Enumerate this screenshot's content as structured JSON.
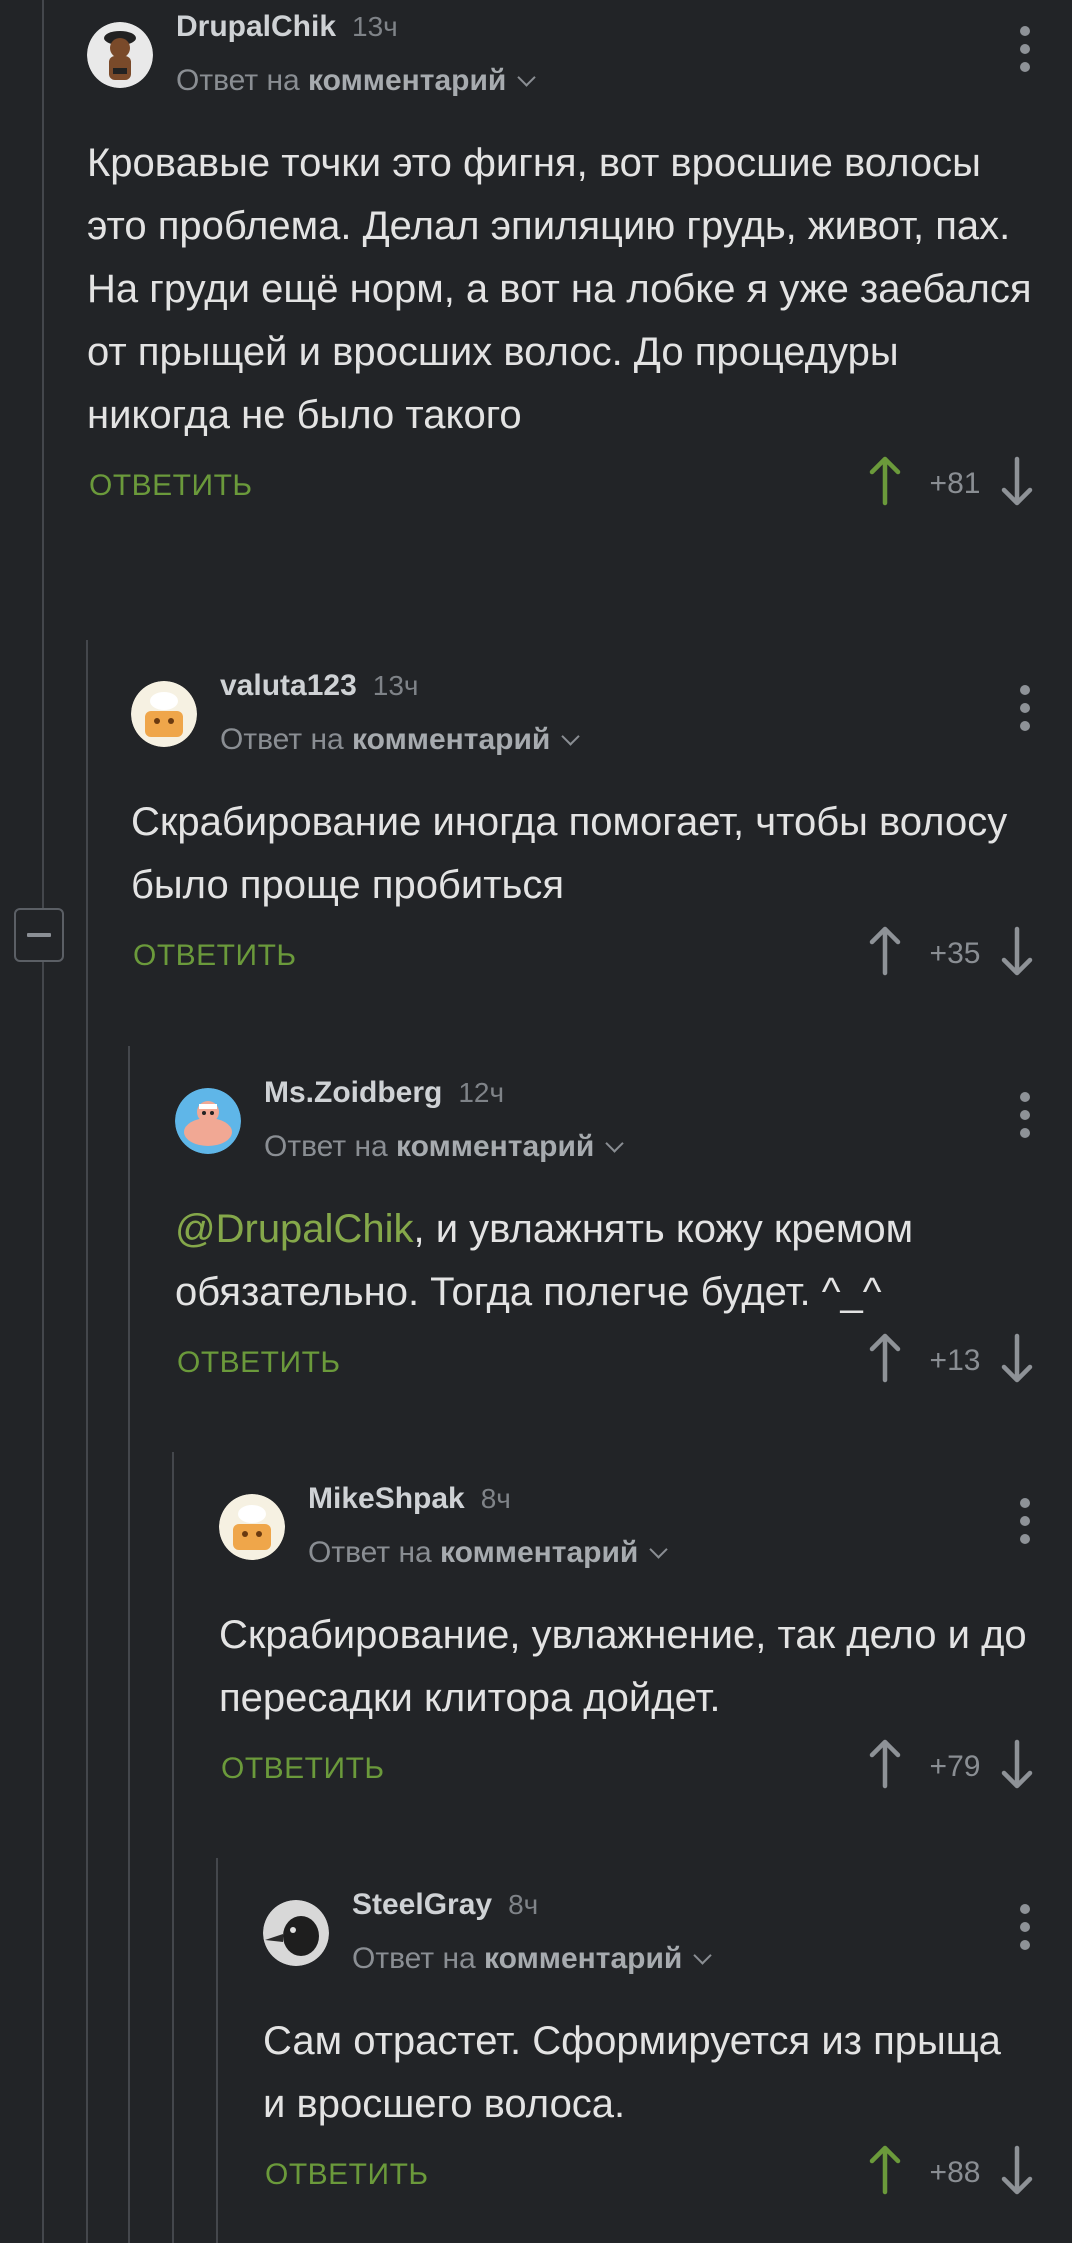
{
  "collapse_label": "−",
  "comments": [
    {
      "username": "DrupalChik",
      "time": "13ч",
      "reply_prefix": "Ответ на",
      "reply_target": "комментарий",
      "mention": "",
      "text": "Кровавые точки это фигня, вот вросшие волосы это проблема. Делал эпиляцию грудь, живот, пах. На груди ещё норм, а вот на лобке я уже заебался от прыщей и вросших волос. До процедуры никогда не было такого",
      "reply_label": "ОТВЕТИТЬ",
      "rating": "+81",
      "upvoted": true
    },
    {
      "username": "valuta123",
      "time": "13ч",
      "reply_prefix": "Ответ на",
      "reply_target": "комментарий",
      "mention": "",
      "text": "Скрабирование иногда помогает, чтобы волосу было проще пробиться",
      "reply_label": "ОТВЕТИТЬ",
      "rating": "+35",
      "upvoted": false
    },
    {
      "username": "Ms.Zoidberg",
      "time": "12ч",
      "reply_prefix": "Ответ на",
      "reply_target": "комментарий",
      "mention": "@DrupalChik",
      "text": ", и увлажнять кожу кремом обязательно. Тогда полегче будет. ^_^",
      "reply_label": "ОТВЕТИТЬ",
      "rating": "+13",
      "upvoted": false
    },
    {
      "username": "MikeShpak",
      "time": "8ч",
      "reply_prefix": "Ответ на",
      "reply_target": "комментарий",
      "mention": "",
      "text": "Скрабирование, увлажнение, так дело и до пересадки клитора дойдет.",
      "reply_label": "ОТВЕТИТЬ",
      "rating": "+79",
      "upvoted": false
    },
    {
      "username": "SteelGray",
      "time": "8ч",
      "reply_prefix": "Ответ на",
      "reply_target": "комментарий",
      "mention": "",
      "text": "Сам отрастет. Сформируется из прыща и вросшего волоса.",
      "reply_label": "ОТВЕТИТЬ",
      "rating": "+88",
      "upvoted": true
    }
  ],
  "colors": {
    "background": "#222427",
    "accent_green": "#6b9a3b",
    "mention": "#85a84a",
    "upvote_active": "#6b9a3b",
    "vote_inactive": "#8e9297"
  }
}
